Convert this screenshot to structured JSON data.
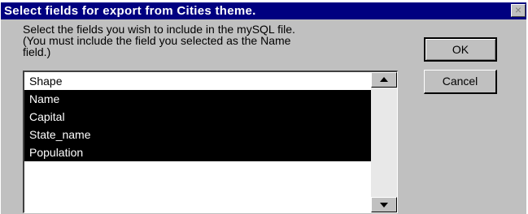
{
  "window": {
    "title": "Select fields for export from Cities theme.",
    "close_glyph": "×"
  },
  "instructions": [
    "Select the fields you wish to include in the mySQL file.",
    "(You must include the field you selected as the Name",
    "field.)"
  ],
  "buttons": {
    "ok_label": "OK",
    "cancel_label": "Cancel"
  },
  "fields": [
    {
      "label": "Shape",
      "selected": false
    },
    {
      "label": "Name",
      "selected": true
    },
    {
      "label": "Capital",
      "selected": true
    },
    {
      "label": "State_name",
      "selected": true
    },
    {
      "label": "Population",
      "selected": true
    }
  ],
  "colors": {
    "titlebar": "#000080",
    "face": "#c0c0c0",
    "selection": "#000000"
  }
}
